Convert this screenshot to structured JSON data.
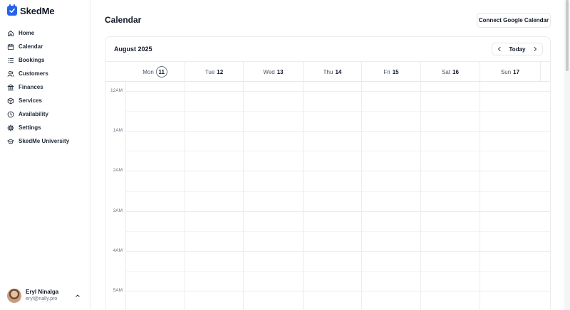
{
  "brand": {
    "name": "SkedMe",
    "color": "#2563eb"
  },
  "sidebar": {
    "items": [
      {
        "label": "Home",
        "icon": "home-icon"
      },
      {
        "label": "Calendar",
        "icon": "calendar-icon"
      },
      {
        "label": "Bookings",
        "icon": "list-icon"
      },
      {
        "label": "Customers",
        "icon": "users-icon"
      },
      {
        "label": "Finances",
        "icon": "bank-icon"
      },
      {
        "label": "Services",
        "icon": "box-icon"
      },
      {
        "label": "Availability",
        "icon": "clock-icon"
      },
      {
        "label": "Settings",
        "icon": "gear-icon"
      },
      {
        "label": "SkedMe University",
        "icon": "graduation-cap-icon"
      }
    ]
  },
  "user": {
    "name": "Eryl Ninalga",
    "email": "eryl@nally.pro"
  },
  "header": {
    "title": "Calendar",
    "connect_label": "Connect Google Calendar"
  },
  "calendar": {
    "month": "August 2025",
    "today_label": "Today",
    "days": [
      {
        "name": "Mon",
        "num": "11",
        "today": true
      },
      {
        "name": "Tue",
        "num": "12"
      },
      {
        "name": "Wed",
        "num": "13"
      },
      {
        "name": "Thu",
        "num": "14"
      },
      {
        "name": "Fri",
        "num": "15"
      },
      {
        "name": "Sat",
        "num": "16"
      },
      {
        "name": "Sun",
        "num": "17"
      }
    ],
    "hours": [
      "12AM",
      "1AM",
      "2AM",
      "3AM",
      "4AM",
      "5AM"
    ]
  }
}
